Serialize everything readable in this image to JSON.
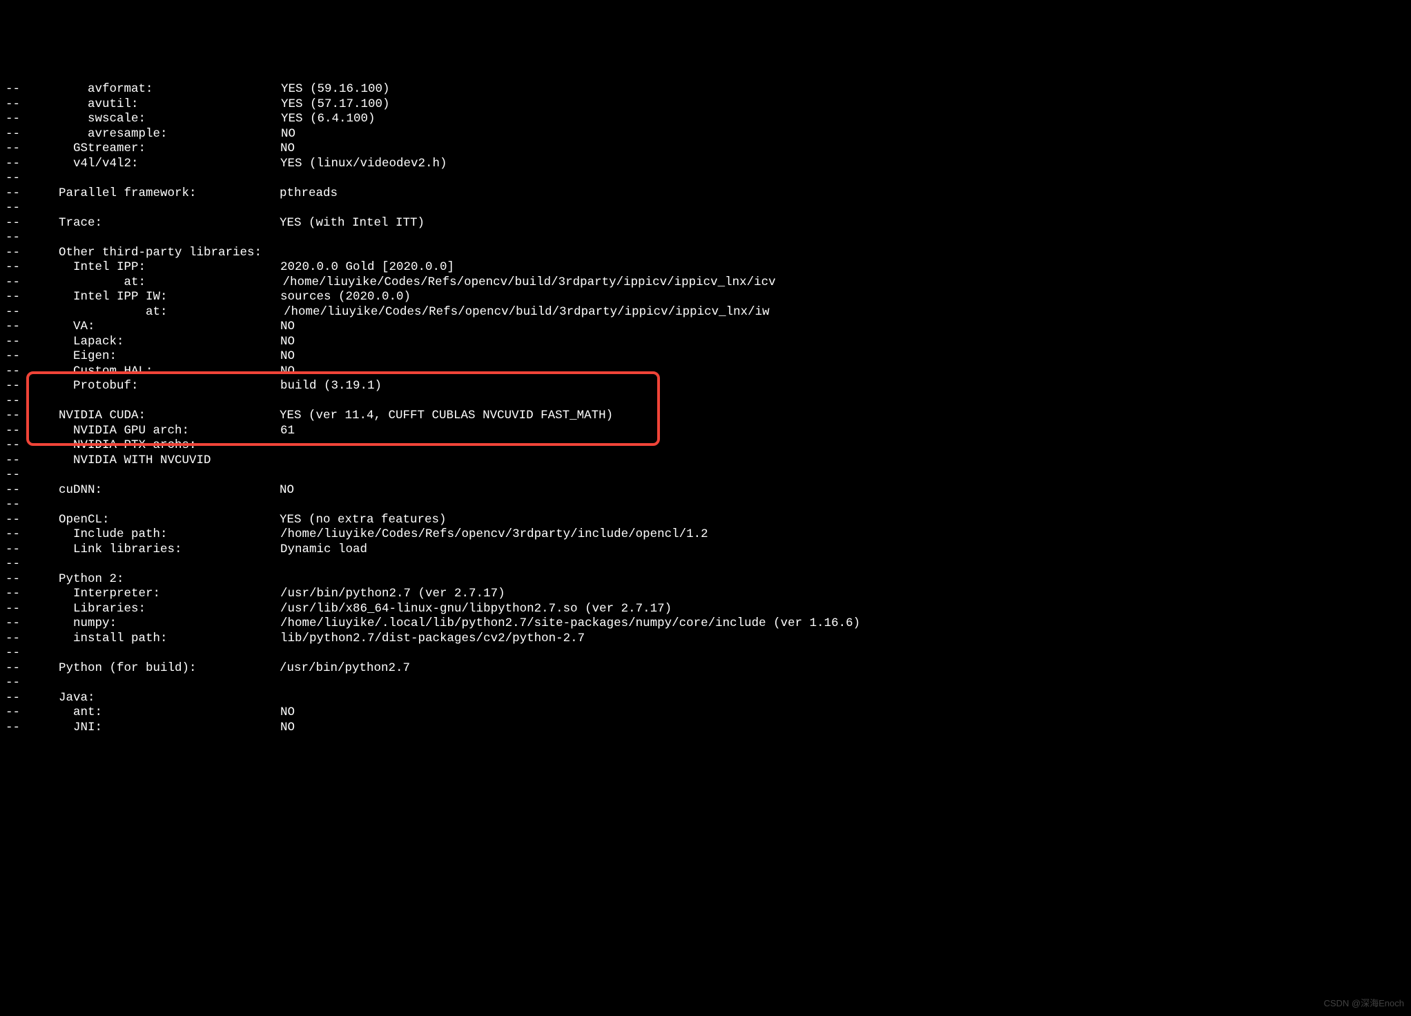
{
  "lines": [
    {
      "indent": "      ",
      "label": "avformat:",
      "labelWidth": 280,
      "value": "YES (59.16.100)",
      "cut": true
    },
    {
      "indent": "      ",
      "label": "avutil:",
      "labelWidth": 280,
      "value": "YES (57.17.100)"
    },
    {
      "indent": "      ",
      "label": "swscale:",
      "labelWidth": 280,
      "value": "YES (6.4.100)"
    },
    {
      "indent": "      ",
      "label": "avresample:",
      "labelWidth": 280,
      "value": "NO"
    },
    {
      "indent": "    ",
      "label": "GStreamer:",
      "labelWidth": 300,
      "value": "NO"
    },
    {
      "indent": "    ",
      "label": "v4l/v4l2:",
      "labelWidth": 300,
      "value": "YES (linux/videodev2.h)"
    },
    {
      "indent": "",
      "label": "",
      "labelWidth": 0,
      "value": ""
    },
    {
      "indent": "  ",
      "label": "Parallel framework:",
      "labelWidth": 320,
      "value": "pthreads"
    },
    {
      "indent": "",
      "label": "",
      "labelWidth": 0,
      "value": ""
    },
    {
      "indent": "  ",
      "label": "Trace:",
      "labelWidth": 320,
      "value": "YES (with Intel ITT)"
    },
    {
      "indent": "",
      "label": "",
      "labelWidth": 0,
      "value": ""
    },
    {
      "indent": "  ",
      "label": "Other third-party libraries:",
      "labelWidth": 320,
      "value": ""
    },
    {
      "indent": "    ",
      "label": "Intel IPP:",
      "labelWidth": 300,
      "value": "2020.0.0 Gold [2020.0.0]"
    },
    {
      "indent": "           ",
      "label": "at:",
      "labelWidth": 230,
      "value": "/home/liuyike/Codes/Refs/opencv/build/3rdparty/ippicv/ippicv_lnx/icv"
    },
    {
      "indent": "    ",
      "label": "Intel IPP IW:",
      "labelWidth": 300,
      "value": "sources (2020.0.0)"
    },
    {
      "indent": "              ",
      "label": "at:",
      "labelWidth": 200,
      "value": "/home/liuyike/Codes/Refs/opencv/build/3rdparty/ippicv/ippicv_lnx/iw"
    },
    {
      "indent": "    ",
      "label": "VA:",
      "labelWidth": 300,
      "value": "NO"
    },
    {
      "indent": "    ",
      "label": "Lapack:",
      "labelWidth": 300,
      "value": "NO"
    },
    {
      "indent": "    ",
      "label": "Eigen:",
      "labelWidth": 300,
      "value": "NO"
    },
    {
      "indent": "    ",
      "label": "Custom HAL:",
      "labelWidth": 300,
      "value": "NO"
    },
    {
      "indent": "    ",
      "label": "Protobuf:",
      "labelWidth": 300,
      "value": "build (3.19.1)"
    },
    {
      "indent": "",
      "label": "",
      "labelWidth": 0,
      "value": ""
    },
    {
      "indent": "  ",
      "label": "NVIDIA CUDA:",
      "labelWidth": 320,
      "value": "YES (ver 11.4, CUFFT CUBLAS NVCUVID FAST_MATH)"
    },
    {
      "indent": "    ",
      "label": "NVIDIA GPU arch:",
      "labelWidth": 300,
      "value": "61"
    },
    {
      "indent": "    ",
      "label": "NVIDIA PTX archs:",
      "labelWidth": 300,
      "value": ""
    },
    {
      "indent": "    ",
      "label": "NVIDIA WITH NVCUVID",
      "labelWidth": 300,
      "value": ""
    },
    {
      "indent": "",
      "label": "",
      "labelWidth": 0,
      "value": ""
    },
    {
      "indent": "  ",
      "label": "cuDNN:",
      "labelWidth": 320,
      "value": "NO"
    },
    {
      "indent": "",
      "label": "",
      "labelWidth": 0,
      "value": ""
    },
    {
      "indent": "  ",
      "label": "OpenCL:",
      "labelWidth": 320,
      "value": "YES (no extra features)"
    },
    {
      "indent": "    ",
      "label": "Include path:",
      "labelWidth": 300,
      "value": "/home/liuyike/Codes/Refs/opencv/3rdparty/include/opencl/1.2"
    },
    {
      "indent": "    ",
      "label": "Link libraries:",
      "labelWidth": 300,
      "value": "Dynamic load"
    },
    {
      "indent": "",
      "label": "",
      "labelWidth": 0,
      "value": ""
    },
    {
      "indent": "  ",
      "label": "Python 2:",
      "labelWidth": 320,
      "value": ""
    },
    {
      "indent": "    ",
      "label": "Interpreter:",
      "labelWidth": 300,
      "value": "/usr/bin/python2.7 (ver 2.7.17)"
    },
    {
      "indent": "    ",
      "label": "Libraries:",
      "labelWidth": 300,
      "value": "/usr/lib/x86_64-linux-gnu/libpython2.7.so (ver 2.7.17)"
    },
    {
      "indent": "    ",
      "label": "numpy:",
      "labelWidth": 300,
      "value": "/home/liuyike/.local/lib/python2.7/site-packages/numpy/core/include (ver 1.16.6)"
    },
    {
      "indent": "    ",
      "label": "install path:",
      "labelWidth": 300,
      "value": "lib/python2.7/dist-packages/cv2/python-2.7"
    },
    {
      "indent": "",
      "label": "",
      "labelWidth": 0,
      "value": ""
    },
    {
      "indent": "  ",
      "label": "Python (for build):",
      "labelWidth": 320,
      "value": "/usr/bin/python2.7"
    },
    {
      "indent": "",
      "label": "",
      "labelWidth": 0,
      "value": ""
    },
    {
      "indent": "  ",
      "label": "Java:",
      "labelWidth": 320,
      "value": ""
    },
    {
      "indent": "    ",
      "label": "ant:",
      "labelWidth": 300,
      "value": "NO"
    },
    {
      "indent": "    ",
      "label": "JNI:",
      "labelWidth": 300,
      "value": "NO"
    }
  ],
  "prefix": "--",
  "watermark": "CSDN @深海Enoch"
}
